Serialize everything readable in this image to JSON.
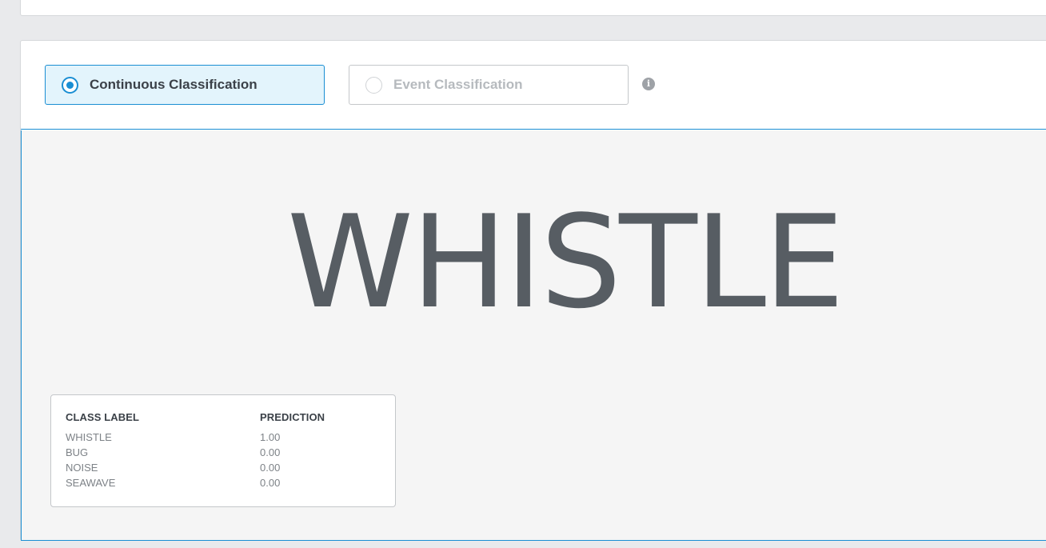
{
  "mode_selector": {
    "options": [
      {
        "label": "Continuous Classification",
        "selected": true
      },
      {
        "label": "Event Classification",
        "selected": false
      }
    ],
    "info_icon": "info-icon"
  },
  "result": {
    "predicted_class": "WHISTLE"
  },
  "prediction_table": {
    "headers": {
      "class_label": "CLASS LABEL",
      "prediction": "PREDICTION"
    },
    "rows": [
      {
        "class_label": "WHISTLE",
        "prediction": "1.00"
      },
      {
        "class_label": "BUG",
        "prediction": "0.00"
      },
      {
        "class_label": "NOISE",
        "prediction": "0.00"
      },
      {
        "class_label": "SEAWAVE",
        "prediction": "0.00"
      }
    ]
  },
  "colors": {
    "accent": "#1a8ed3",
    "active_bg": "#e3f4fc",
    "text_dark": "#3b4148",
    "text_muted": "#7d8287"
  }
}
